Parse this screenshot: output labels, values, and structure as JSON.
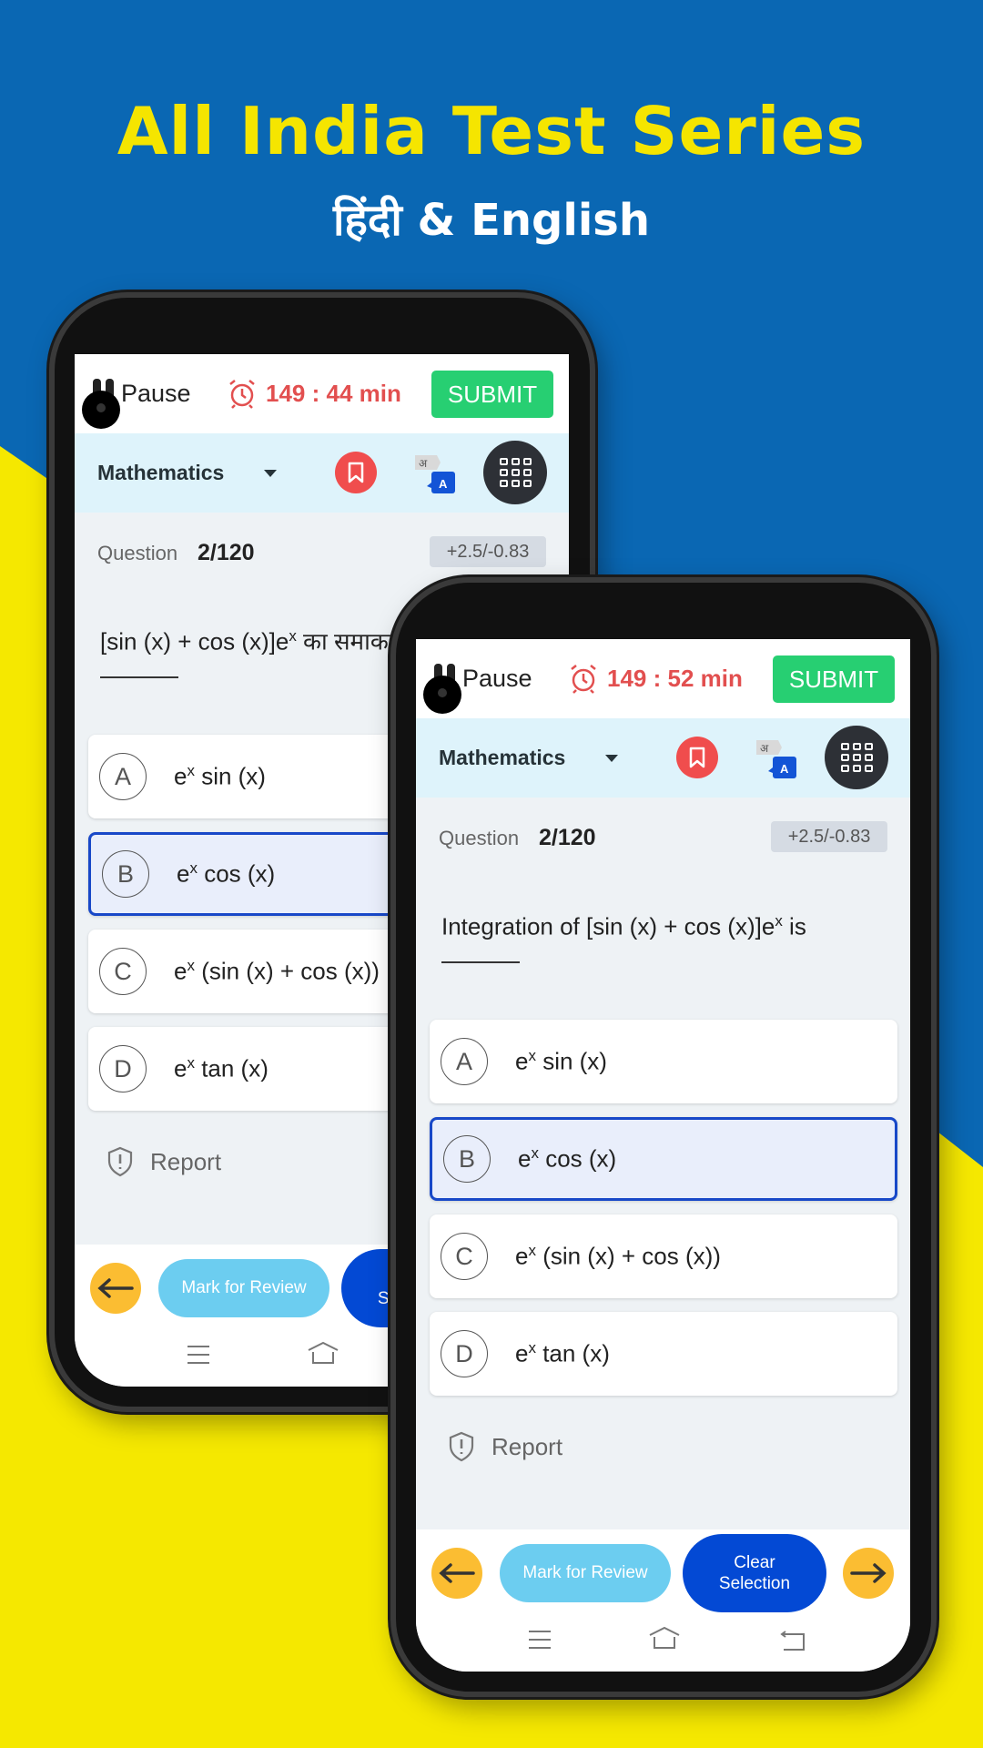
{
  "promo": {
    "title": "All India Test Series",
    "subtitle": "हिंदी & English"
  },
  "colors": {
    "blue_bg": "#0a67b3",
    "yellow_bg": "#f5e800",
    "submit": "#27cf72",
    "timer": "#e24f4f",
    "clear": "#0349d4",
    "mark": "#6ccdf0",
    "arrow": "#fbbd32"
  },
  "phones": [
    {
      "pause_label": "Pause",
      "timer": "149 : 44 min",
      "submit_label": "SUBMIT",
      "subject": "Mathematics",
      "question_label": "Question",
      "question_number": "2/120",
      "marks": "+2.5/-0.83",
      "question_pre": "[sin (x) + cos (x)]e",
      "question_sup": "x",
      "question_post": " का समाकलन",
      "options": [
        {
          "letter": "A",
          "base": "e",
          "sup": "x",
          "text": " sin (x)",
          "selected": false
        },
        {
          "letter": "B",
          "base": "e",
          "sup": "x",
          "text": " cos (x)",
          "selected": true
        },
        {
          "letter": "C",
          "base": "e",
          "sup": "x",
          "text": " (sin (x) + cos (x))",
          "selected": false
        },
        {
          "letter": "D",
          "base": "e",
          "sup": "x",
          "text": " tan (x)",
          "selected": false
        }
      ],
      "report_label": "Report",
      "mark_review_label": "Mark for Review",
      "clear_selection_label": "Clear Selection"
    },
    {
      "pause_label": "Pause",
      "timer": "149 : 52 min",
      "submit_label": "SUBMIT",
      "subject": "Mathematics",
      "question_label": "Question",
      "question_number": "2/120",
      "marks": "+2.5/-0.83",
      "question_pre": "Integration of [sin (x) + cos (x)]e",
      "question_sup": "x",
      "question_post": " is",
      "options": [
        {
          "letter": "A",
          "base": "e",
          "sup": "x",
          "text": " sin (x)",
          "selected": false
        },
        {
          "letter": "B",
          "base": "e",
          "sup": "x",
          "text": " cos (x)",
          "selected": true
        },
        {
          "letter": "C",
          "base": "e",
          "sup": "x",
          "text": " (sin (x) + cos (x))",
          "selected": false
        },
        {
          "letter": "D",
          "base": "e",
          "sup": "x",
          "text": " tan (x)",
          "selected": false
        }
      ],
      "report_label": "Report",
      "mark_review_label": "Mark for Review",
      "clear_selection_label": "Clear Selection"
    }
  ]
}
